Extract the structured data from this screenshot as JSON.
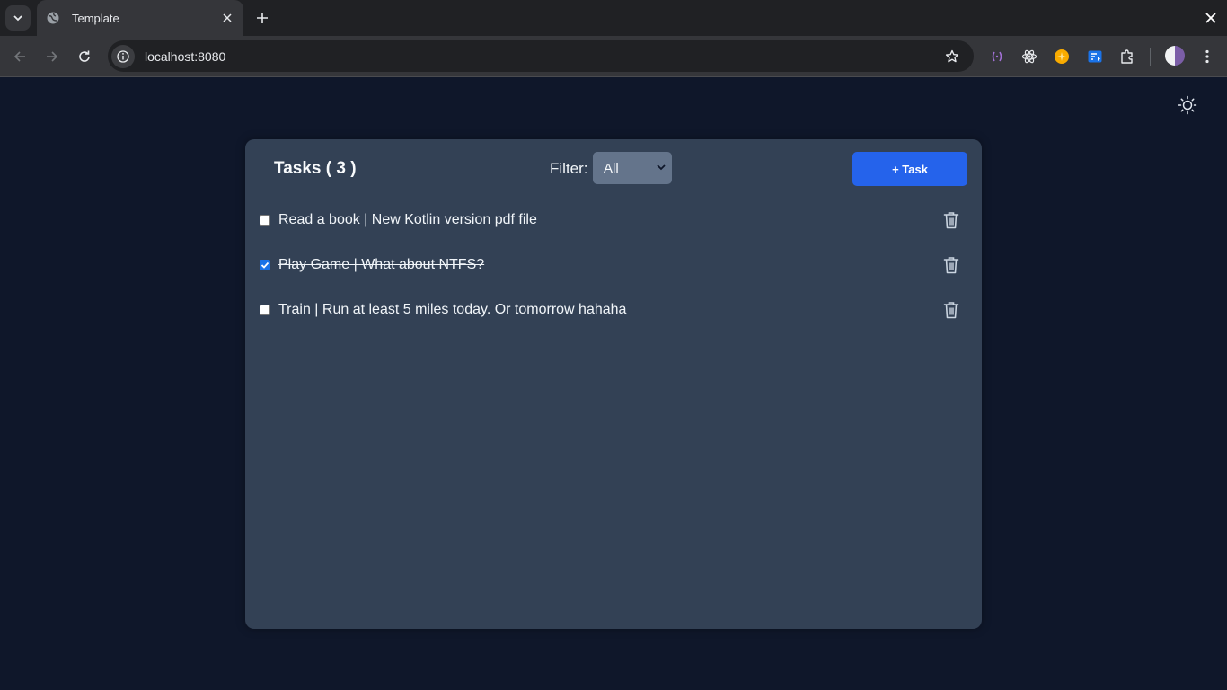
{
  "browser": {
    "tab_title": "Template",
    "url": "localhost:8080"
  },
  "app": {
    "title": "Tasks ( 3 )",
    "filter_label": "Filter:",
    "filter_value": "All",
    "add_button_label": "+ Task",
    "tasks": [
      {
        "text": "Read a book | New Kotlin version pdf file",
        "done": false
      },
      {
        "text": "Play Game | What about NTFS?",
        "done": true
      },
      {
        "text": "Train | Run at least 5 miles today. Or tomorrow hahaha",
        "done": false
      }
    ]
  },
  "colors": {
    "page_background": "#0f172a",
    "card_background": "#334155",
    "accent": "#2563eb",
    "select_background": "#64748b"
  },
  "icons": [
    "tab-search-icon",
    "globe-icon",
    "close-icon",
    "plus-icon",
    "back-arrow-icon",
    "forward-arrow-icon",
    "reload-icon",
    "info-icon",
    "star-icon",
    "extension-icon",
    "puzzle-icon",
    "kebab-menu-icon",
    "sun-icon",
    "trash-icon"
  ]
}
